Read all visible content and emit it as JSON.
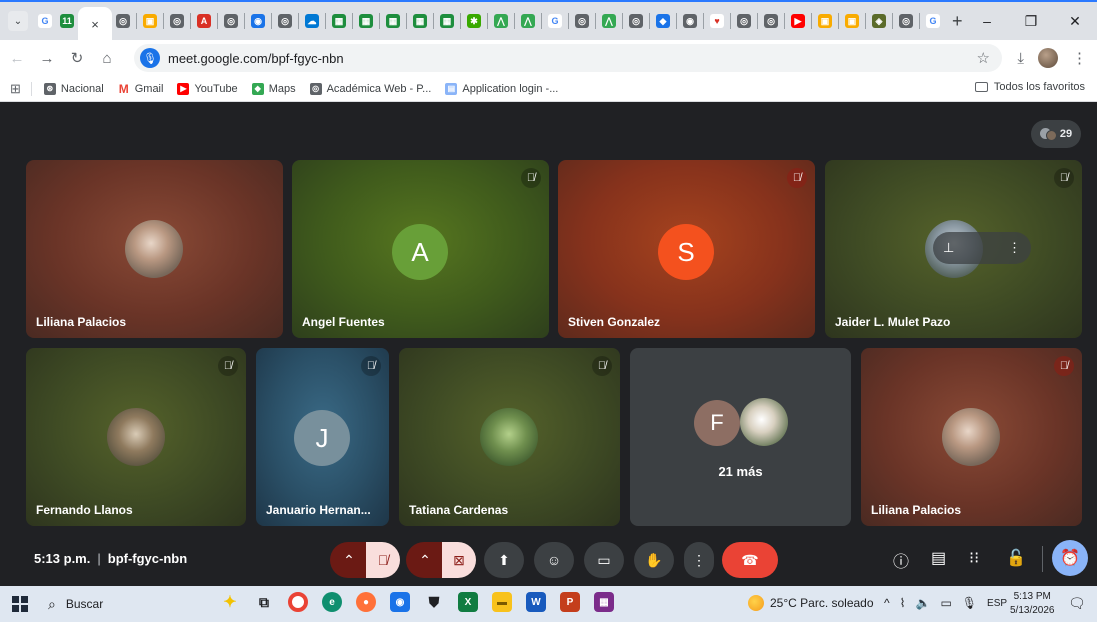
{
  "browser": {
    "url": "meet.google.com/bpf-fgyc-nbn",
    "window_controls": [
      "–",
      "❐",
      "✕"
    ],
    "tab_close": "×",
    "new_tab": "+"
  },
  "bookmarks": {
    "items": [
      {
        "label": "Nacional",
        "color": "#5f6368",
        "glyph": "⊛"
      },
      {
        "label": "Gmail",
        "color": "#ea4335",
        "glyph": "M"
      },
      {
        "label": "YouTube",
        "color": "#ff0000",
        "glyph": "▶"
      },
      {
        "label": "Maps",
        "color": "#34a853",
        "glyph": "◆"
      },
      {
        "label": "Académica Web - P...",
        "color": "#5f6368",
        "glyph": "◎"
      },
      {
        "label": "Application login -...",
        "color": "#8ab4f8",
        "glyph": "▤"
      }
    ],
    "all_bookmarks": "Todos los favoritos"
  },
  "meet": {
    "participant_count": "29",
    "tiles": [
      {
        "name": "Liliana Palacios"
      },
      {
        "name": "Angel Fuentes",
        "initial": "A"
      },
      {
        "name": "Stiven Gonzalez",
        "initial": "S"
      },
      {
        "name": "Jaider L. Mulet Pazo"
      },
      {
        "name": "Fernando Llanos"
      },
      {
        "name": "Januario Hernan...",
        "initial": "J"
      },
      {
        "name": "Tatiana Cardenas"
      },
      {
        "name": "21 más",
        "initial": "F"
      },
      {
        "name": "Liliana Palacios"
      }
    ],
    "pin_glyph": "⊥",
    "more_glyph": "⋮"
  },
  "controls": {
    "time": "5:13 p.m.",
    "separator": "|",
    "meeting_code": "bpf-fgyc-nbn"
  },
  "taskbar": {
    "search_placeholder": "Buscar",
    "weather": "25°C  Parc. soleado",
    "language": "ESP",
    "time": "5:13 PM",
    "date": "5/13/2026"
  }
}
